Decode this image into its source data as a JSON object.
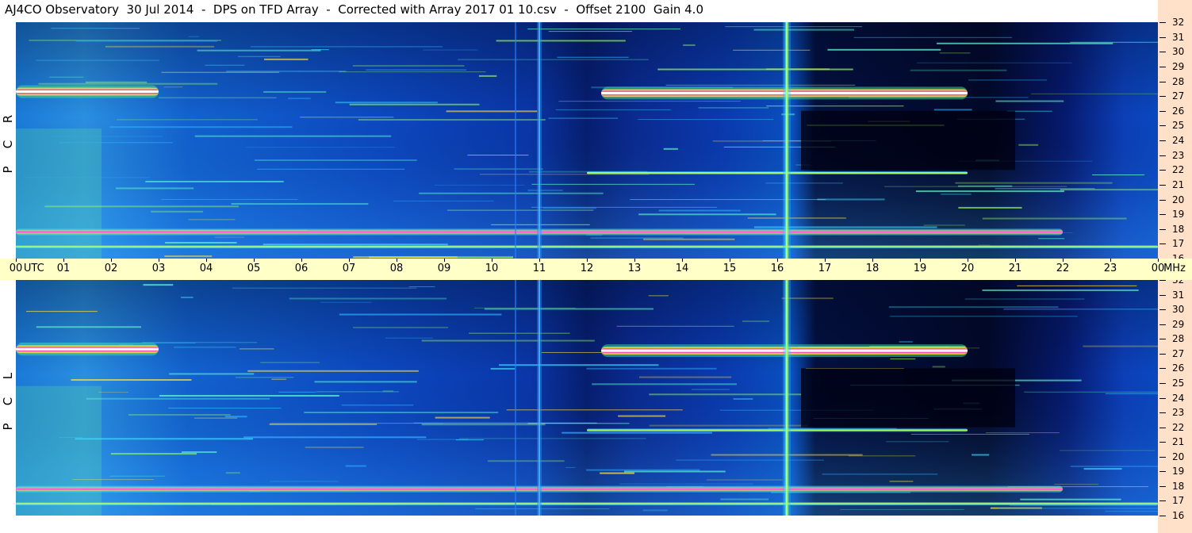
{
  "title": "AJ4CO Observatory  30 Jul 2014  -  DPS on TFD Array  -  Corrected with Array 2017 01 10.csv  -  Offset 2100  Gain 4.0",
  "panels": [
    {
      "polarization_letters": [
        "R",
        "C",
        "P"
      ]
    },
    {
      "polarization_letters": [
        "L",
        "C",
        "P"
      ]
    }
  ],
  "time_axis": {
    "unit_label": "UTC",
    "ticks": [
      "00",
      "01",
      "02",
      "03",
      "04",
      "05",
      "06",
      "07",
      "08",
      "09",
      "10",
      "11",
      "12",
      "13",
      "14",
      "15",
      "16",
      "17",
      "18",
      "19",
      "20",
      "21",
      "22",
      "23",
      "00"
    ]
  },
  "freq_axis": {
    "unit_label": "MHz",
    "ticks": [
      "32",
      "31",
      "30",
      "29",
      "28",
      "27",
      "26",
      "25",
      "24",
      "23",
      "22",
      "21",
      "20",
      "19",
      "18",
      "17",
      "16"
    ]
  },
  "colors": {
    "background_deep": "#00062a",
    "background_blue": "#0a2aa8",
    "time_axis_band": "#ffffc8",
    "freq_axis_band": "#ffe0c8"
  },
  "chart_data": {
    "type": "heatmap",
    "title": "AJ4CO Observatory  30 Jul 2014  -  DPS on TFD Array  -  Corrected with Array 2017 01 10.csv  -  Offset 2100  Gain 4.0",
    "xlabel": "UTC",
    "ylabel": "MHz",
    "xlim": [
      0,
      24
    ],
    "ylim": [
      16,
      32
    ],
    "colormap": "spectrogram (black-blue-cyan-green-yellow-magenta-white)",
    "polarizations": [
      "RCP",
      "LCP"
    ],
    "features": [
      {
        "kind": "band",
        "freq_mhz": 27.3,
        "time_utc": [
          0,
          3
        ],
        "intensity": "saturated"
      },
      {
        "kind": "band",
        "freq_mhz": 27.2,
        "time_utc": [
          12.3,
          20
        ],
        "intensity": "saturated"
      },
      {
        "kind": "band",
        "freq_mhz": 17.8,
        "time_utc": [
          0,
          22
        ],
        "intensity": "high"
      },
      {
        "kind": "band",
        "freq_mhz": 21.8,
        "time_utc": [
          12,
          20
        ],
        "intensity": "medium"
      },
      {
        "kind": "band",
        "freq_mhz": 16.8,
        "time_utc": [
          0,
          24
        ],
        "intensity": "medium"
      },
      {
        "kind": "vertical_line",
        "time_utc": 16.2,
        "intensity": "high"
      },
      {
        "kind": "vertical_line",
        "time_utc": 11.0,
        "intensity": "medium"
      },
      {
        "kind": "vertical_line",
        "time_utc": 10.5,
        "intensity": "low"
      },
      {
        "kind": "dark_region",
        "time_utc": [
          16.5,
          21
        ],
        "freq_mhz": [
          22,
          26
        ],
        "intensity": "low"
      }
    ]
  }
}
